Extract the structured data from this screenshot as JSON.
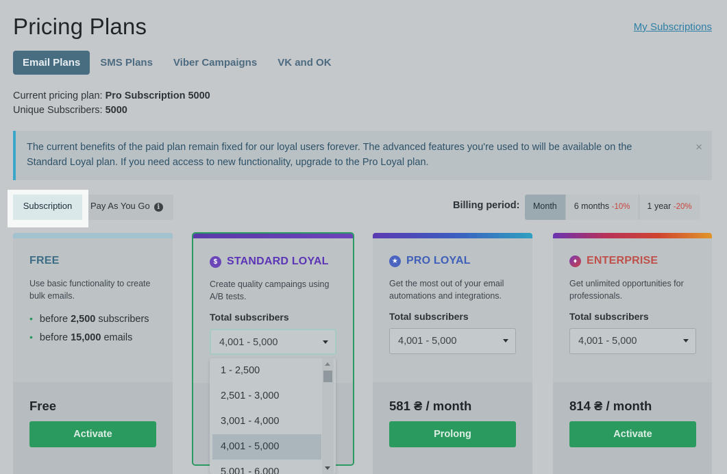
{
  "page": {
    "title": "Pricing Plans",
    "my_subscriptions": "My Subscriptions"
  },
  "tabs": [
    {
      "label": "Email Plans",
      "active": true
    },
    {
      "label": "SMS Plans"
    },
    {
      "label": "Viber Campaigns"
    },
    {
      "label": "VK and OK"
    }
  ],
  "current": {
    "plan_label": "Current pricing plan:",
    "plan_value": "Pro Subscription 5000",
    "subs_label": "Unique Subscribers:",
    "subs_value": "5000"
  },
  "alert": {
    "text": "The current benefits of the paid plan remain fixed for our loyal users forever. The advanced features you're used to will be available on the Standard Loyal plan. If you need access to new functionality, upgrade to the Pro Loyal plan.",
    "close": "×"
  },
  "mode_toggle": {
    "subscription": "Subscription",
    "payg": "Pay As You Go",
    "info_icon": "i"
  },
  "billing": {
    "label": "Billing period:",
    "options": [
      {
        "label": "Month",
        "discount": ""
      },
      {
        "label": "6 months",
        "discount": "-10%"
      },
      {
        "label": "1 year",
        "discount": "-20%"
      }
    ]
  },
  "plans": {
    "free": {
      "title": "FREE",
      "desc": "Use basic functionality to create bulk emails.",
      "bullets": [
        {
          "pre": "before ",
          "num": "2,500",
          "post": " subscribers"
        },
        {
          "pre": "before ",
          "num": "15,000",
          "post": " emails"
        }
      ],
      "price": "Free",
      "button": "Activate"
    },
    "standard": {
      "title": "STANDARD LOYAL",
      "icon": "$",
      "desc": "Create quality campaings using A/B tests.",
      "total_label": "Total subscribers",
      "select": "4,001 - 5,000"
    },
    "pro": {
      "title": "PRO LOYAL",
      "icon": "★",
      "desc": "Get the most out of your email automations and integrations.",
      "total_label": "Total subscribers",
      "select": "4,001 - 5,000",
      "price": "581 ₴ / month",
      "button": "Prolong"
    },
    "enterprise": {
      "title": "ENTERPRISE",
      "icon": "♦",
      "desc": "Get unlimited opportunities for professionals.",
      "total_label": "Total subscribers",
      "select": "4,001 - 5,000",
      "price": "814 ₴ / month",
      "button": "Activate"
    }
  },
  "dropdown": {
    "options": [
      "1 - 2,500",
      "2,501 - 3,000",
      "3,001 - 4,000",
      "4,001 - 5,000",
      "5,001 - 6,000"
    ],
    "selected_index": 3
  },
  "colors": {
    "free_bar": "#a3c2cf",
    "standard_title": "#5b35b5",
    "pro_title": "#3f5fb8",
    "enterprise_title": "#c0504a",
    "button_green": "#2a9a5f",
    "link": "#2e7fa6"
  }
}
